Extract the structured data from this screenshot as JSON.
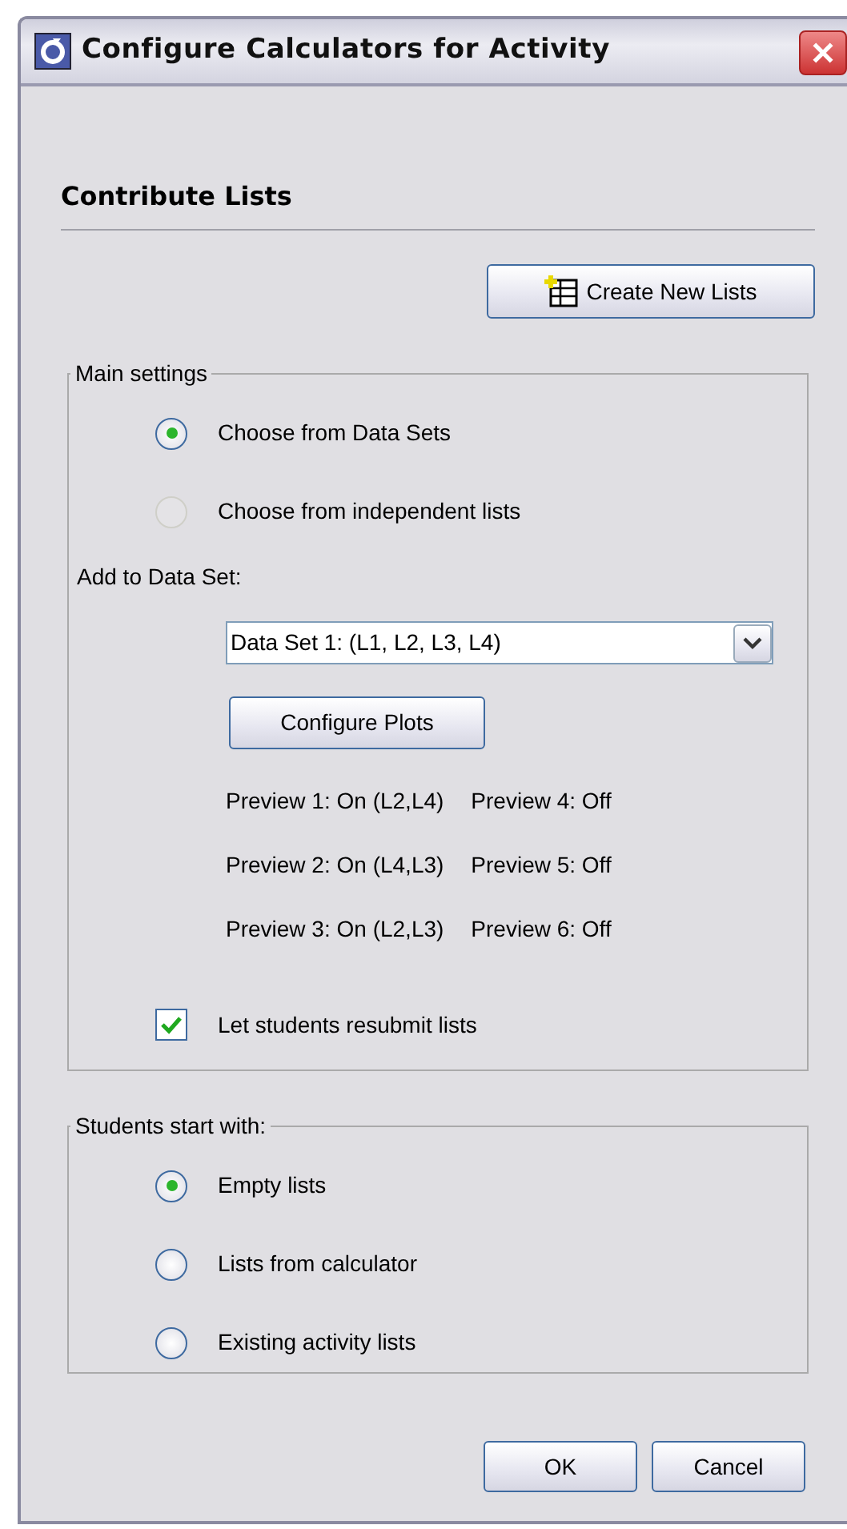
{
  "window": {
    "title": "Configure Calculators for Activity"
  },
  "heading": "Contribute Lists",
  "create_button": "Create New Lists",
  "main_settings": {
    "legend": "Main settings",
    "source_options": [
      {
        "label": "Choose from Data Sets",
        "selected": true,
        "disabled": false
      },
      {
        "label": "Choose from independent lists",
        "selected": false,
        "disabled": true
      }
    ],
    "add_label": "Add to Data Set:",
    "data_set": {
      "value": "Data Set 1: (L1, L2, L3, L4)"
    },
    "configure_button": "Configure Plots",
    "previews": [
      [
        "Preview 1: On (L2,L4)",
        "Preview 4: Off"
      ],
      [
        "Preview 2: On (L4,L3)",
        "Preview 5: Off"
      ],
      [
        "Preview 3: On (L2,L3)",
        "Preview 6: Off"
      ]
    ],
    "resubmit": {
      "label": "Let students resubmit lists",
      "checked": true
    }
  },
  "start_with": {
    "legend": "Students start with:",
    "options": [
      {
        "label": "Empty lists",
        "selected": true,
        "disabled": false
      },
      {
        "label": "Lists from calculator",
        "selected": false,
        "disabled": false
      },
      {
        "label": "Existing activity lists",
        "selected": false,
        "disabled": false
      }
    ]
  },
  "buttons": [
    "OK",
    "Cancel"
  ]
}
